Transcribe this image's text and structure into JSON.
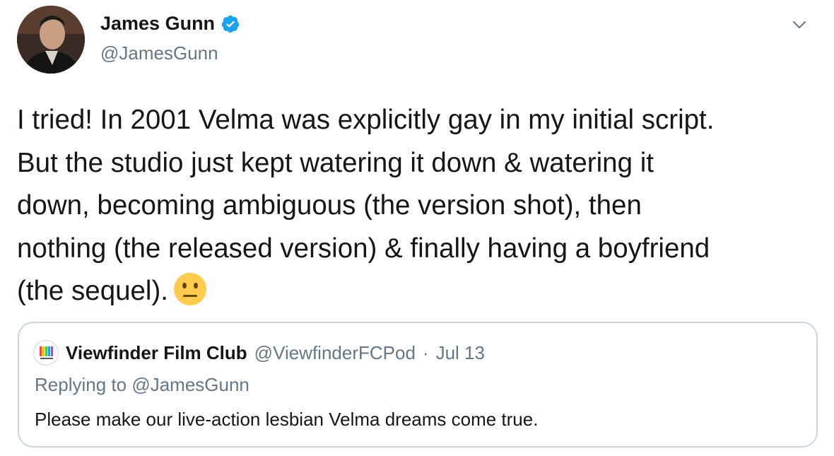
{
  "author": {
    "name": "James Gunn",
    "handle": "@JamesGunn",
    "verified_icon": "verified-badge-icon",
    "verified_color": "#1da1f2"
  },
  "menu": {
    "icon": "chevron-down-icon"
  },
  "tweet": {
    "text": "I tried! In 2001 Velma was explicitly gay in my initial script.\nBut the studio just kept watering it down & watering it\ndown, becoming ambiguous (the version shot), then\nnothing (the released version) & finally having a boyfriend\n(the sequel).",
    "emoji": "neutral-face-emoji"
  },
  "quoted": {
    "name": "Viewfinder Film Club",
    "handle": "@ViewfinderFCPod",
    "separator": "·",
    "date": "Jul 13",
    "replying_prefix": "Replying to",
    "replying_handle": "@JamesGunn",
    "text": "Please make our live-action lesbian Velma dreams come true."
  },
  "colors": {
    "text": "#14171a",
    "secondary": "#657786",
    "border": "#ccd6dd",
    "link": "#1da1f2"
  }
}
